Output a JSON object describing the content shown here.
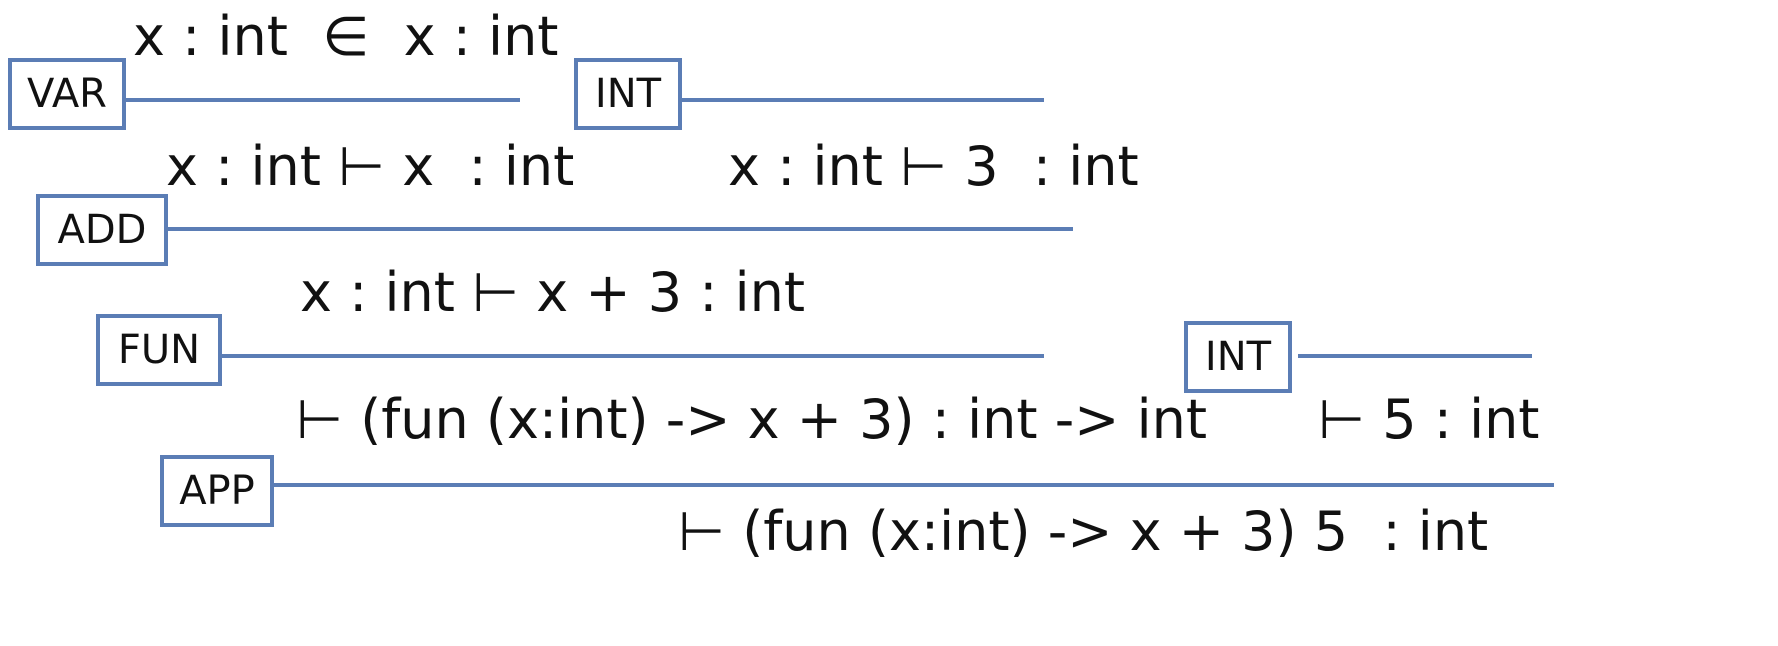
{
  "theme": {
    "rule_color": "#5b7db5",
    "text_color": "#111111",
    "background": "#ffffff"
  },
  "derivation": {
    "var_premise": "x : int  ∈  x : int",
    "var_rule": "VAR",
    "var_conclusion": "x : int ⊢ x  : int",
    "int1_rule": "INT",
    "int1_conclusion": "x : int ⊢ 3  : int",
    "add_rule": "ADD",
    "add_conclusion": "x : int ⊢ x + 3 : int",
    "fun_rule": "FUN",
    "fun_conclusion": "⊢ (fun (x:int) -> x + 3) : int -> int",
    "int2_rule": "INT",
    "int2_conclusion": "⊢ 5 : int",
    "app_rule": "APP",
    "app_conclusion": "⊢ (fun (x:int) -> x + 3) 5  : int"
  }
}
